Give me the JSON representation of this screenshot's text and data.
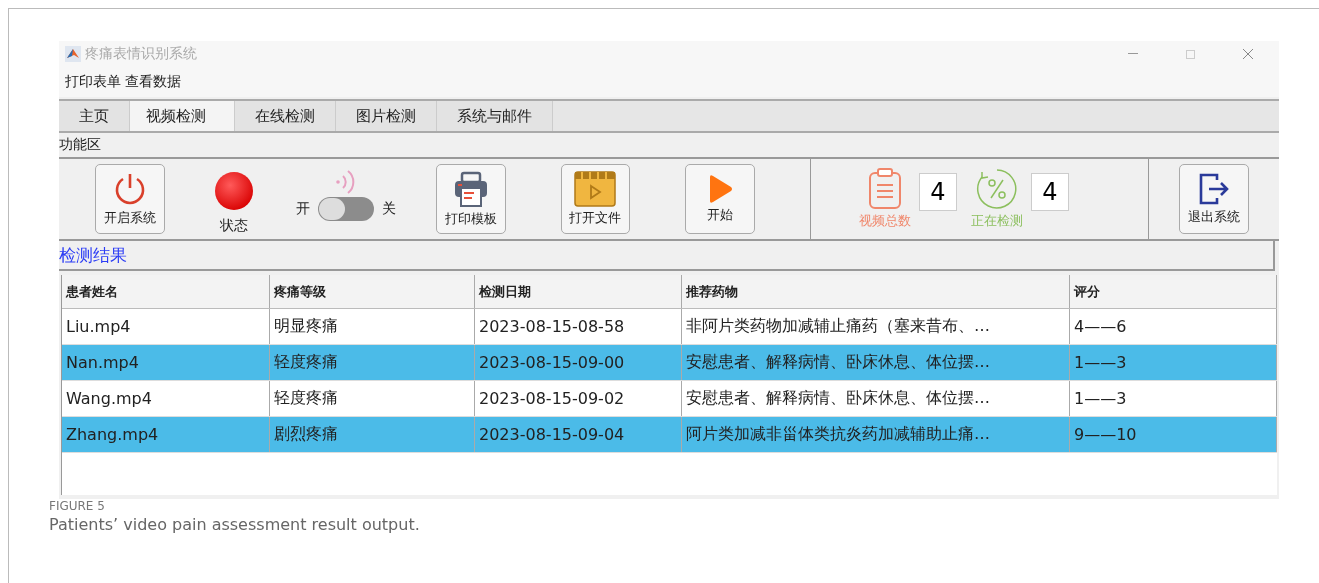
{
  "window": {
    "title": "疼痛表情识别系统"
  },
  "menu": [
    "打印表单",
    "查看数据"
  ],
  "tabs": [
    {
      "label": "主页",
      "selected": false
    },
    {
      "label": "视频检测",
      "selected": true
    },
    {
      "label": "在线检测",
      "selected": false
    },
    {
      "label": "图片检测",
      "selected": false
    },
    {
      "label": "系统与邮件",
      "selected": false
    }
  ],
  "function_area": "功能区",
  "toolbar": [
    {
      "kind": "power",
      "label": "开启系统"
    },
    {
      "kind": "status",
      "label": "状态"
    },
    {
      "kind": "toggle",
      "on_label": "开",
      "off_label": "关",
      "on": false
    },
    {
      "kind": "printer",
      "label": "打印模板"
    },
    {
      "kind": "file",
      "label": "打开文件"
    },
    {
      "kind": "play",
      "label": "开始"
    }
  ],
  "counters": [
    {
      "kind": "clipboard",
      "label": "视频总数",
      "value": "4",
      "color": "#f0866a"
    },
    {
      "kind": "percent",
      "label": "正在检测",
      "value": "4",
      "color": "#8cbf5e"
    }
  ],
  "exit_button": "退出系统",
  "results_label": "检测结果",
  "table": {
    "columns": [
      "患者姓名",
      "疼痛等级",
      "检测日期",
      "推荐药物",
      "评分"
    ],
    "rows": [
      {
        "cells": [
          "Liu.mp4",
          "明显疼痛",
          "2023-08-15-08-58",
          "非阿片类药物加减辅止痛药（塞来昔布、…",
          "4——6"
        ],
        "selected": false
      },
      {
        "cells": [
          "Nan.mp4",
          "轻度疼痛",
          "2023-08-15-09-00",
          "安慰患者、解释病情、卧床休息、体位摆…",
          "1——3"
        ],
        "selected": true
      },
      {
        "cells": [
          "Wang.mp4",
          "轻度疼痛",
          "2023-08-15-09-02",
          "安慰患者、解释病情、卧床休息、体位摆…",
          "1——3"
        ],
        "selected": false
      },
      {
        "cells": [
          "Zhang.mp4",
          "剧烈疼痛",
          "2023-08-15-09-04",
          "阿片类加减非甾体类抗炎药加减辅助止痛…",
          "9——10"
        ],
        "selected": true
      }
    ]
  },
  "caption": {
    "label": "FIGURE 5",
    "text": "Patients’ video pain assessment result output."
  }
}
